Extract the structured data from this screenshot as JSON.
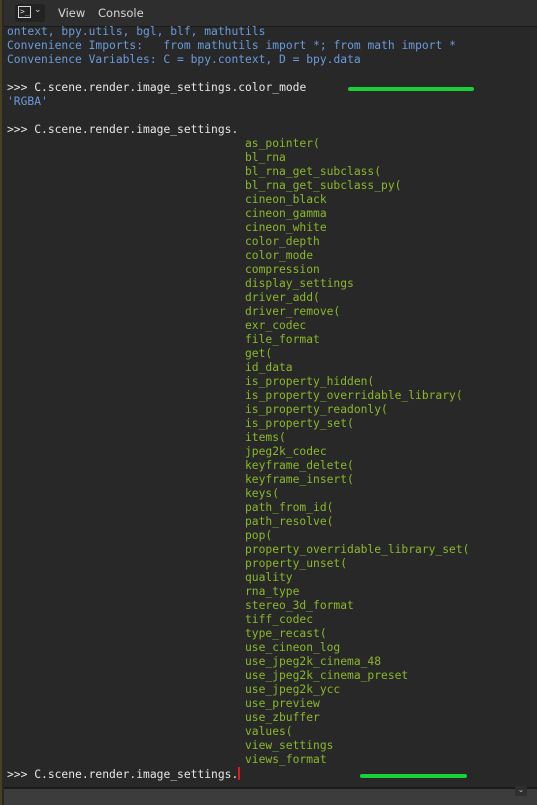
{
  "header": {
    "editor_type_icon": "console-icon",
    "editor_type_glyph": ">_",
    "chevron": "⌄",
    "menus": [
      "View",
      "Console"
    ]
  },
  "console": {
    "banner": [
      "ontext, bpy.utils, bgl, blf, mathutils",
      "Convenience Imports:   from mathutils import *; from math import *",
      "Convenience Variables: C = bpy.context, D = bpy.data"
    ],
    "prompt": ">>> ",
    "command1": "C.scene.render.image_settings.color_mode",
    "result1": "'RGBA'",
    "command2": "C.scene.render.image_settings.",
    "completions": [
      "as_pointer(",
      "bl_rna",
      "bl_rna_get_subclass(",
      "bl_rna_get_subclass_py(",
      "cineon_black",
      "cineon_gamma",
      "cineon_white",
      "color_depth",
      "color_mode",
      "compression",
      "display_settings",
      "driver_add(",
      "driver_remove(",
      "exr_codec",
      "file_format",
      "get(",
      "id_data",
      "is_property_hidden(",
      "is_property_overridable_library(",
      "is_property_readonly(",
      "is_property_set(",
      "items(",
      "jpeg2k_codec",
      "keyframe_delete(",
      "keyframe_insert(",
      "keys(",
      "path_from_id(",
      "path_resolve(",
      "pop(",
      "property_overridable_library_set(",
      "property_unset(",
      "quality",
      "rna_type",
      "stereo_3d_format",
      "tiff_codec",
      "type_recast(",
      "use_cineon_log",
      "use_jpeg2k_cinema_48",
      "use_jpeg2k_cinema_preset",
      "use_jpeg2k_ycc",
      "use_preview",
      "use_zbuffer",
      "values(",
      "view_settings",
      "views_format"
    ],
    "input_line": "C.scene.render.image_settings."
  },
  "footer": {
    "expand_icon": "⌄"
  },
  "colors": {
    "output_blue": "#6a9bdc",
    "autocomplete_green": "#8ab82a",
    "annotation_green": "#16d13a",
    "cursor_red": "#e01818"
  }
}
